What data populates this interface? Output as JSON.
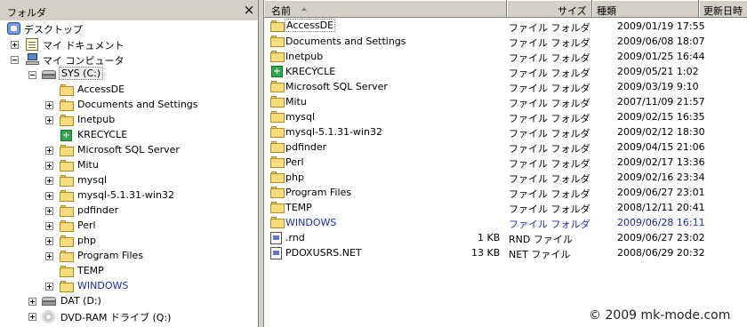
{
  "left_pane": {
    "title": "フォルダ",
    "close_glyph": "×",
    "tree": [
      {
        "label": "デスクトップ",
        "icon": "desktop-icon"
      },
      {
        "label": "マイ ドキュメント",
        "icon": "documents-icon"
      },
      {
        "label": "マイ コンピュータ",
        "icon": "computer-icon"
      },
      {
        "label": "SYS (C:)",
        "icon": "drive-icon"
      },
      {
        "label": "AccessDE",
        "icon": "folder-icon"
      },
      {
        "label": "Documents and Settings",
        "icon": "folder-icon"
      },
      {
        "label": "Inetpub",
        "icon": "folder-icon"
      },
      {
        "label": "KRECYCLE",
        "icon": "recycle-icon"
      },
      {
        "label": "Microsoft SQL Server",
        "icon": "folder-icon"
      },
      {
        "label": "Mitu",
        "icon": "folder-icon"
      },
      {
        "label": "mysql",
        "icon": "folder-icon"
      },
      {
        "label": "mysql-5.1.31-win32",
        "icon": "folder-icon"
      },
      {
        "label": "pdfinder",
        "icon": "folder-icon"
      },
      {
        "label": "Perl",
        "icon": "folder-icon"
      },
      {
        "label": "php",
        "icon": "folder-icon"
      },
      {
        "label": "Program Files",
        "icon": "folder-icon"
      },
      {
        "label": "TEMP",
        "icon": "folder-icon"
      },
      {
        "label": "WINDOWS",
        "icon": "folder-icon"
      },
      {
        "label": "DAT (D:)",
        "icon": "drive-icon"
      },
      {
        "label": "DVD-RAM ドライブ (Q:)",
        "icon": "dvd-icon"
      }
    ]
  },
  "right_pane": {
    "columns": {
      "name": "名前",
      "size": "サイズ",
      "type": "種類",
      "modified": "更新日時"
    },
    "rows": [
      {
        "name": "AccessDE",
        "size": "",
        "type": "ファイル フォルダ",
        "modified": "2009/01/19 17:55",
        "icon": "folder-icon"
      },
      {
        "name": "Documents and Settings",
        "size": "",
        "type": "ファイル フォルダ",
        "modified": "2009/06/08 18:07",
        "icon": "folder-icon"
      },
      {
        "name": "Inetpub",
        "size": "",
        "type": "ファイル フォルダ",
        "modified": "2009/01/25 16:44",
        "icon": "folder-icon"
      },
      {
        "name": "KRECYCLE",
        "size": "",
        "type": "ファイル フォルダ",
        "modified": "2009/05/21 1:02",
        "icon": "recycle-icon"
      },
      {
        "name": "Microsoft SQL Server",
        "size": "",
        "type": "ファイル フォルダ",
        "modified": "2009/03/19 9:10",
        "icon": "folder-icon"
      },
      {
        "name": "Mitu",
        "size": "",
        "type": "ファイル フォルダ",
        "modified": "2007/11/09 21:57",
        "icon": "folder-icon"
      },
      {
        "name": "mysql",
        "size": "",
        "type": "ファイル フォルダ",
        "modified": "2009/02/15 16:35",
        "icon": "folder-icon"
      },
      {
        "name": "mysql-5.1.31-win32",
        "size": "",
        "type": "ファイル フォルダ",
        "modified": "2009/02/12 18:30",
        "icon": "folder-icon"
      },
      {
        "name": "pdfinder",
        "size": "",
        "type": "ファイル フォルダ",
        "modified": "2009/04/15 21:06",
        "icon": "folder-icon"
      },
      {
        "name": "Perl",
        "size": "",
        "type": "ファイル フォルダ",
        "modified": "2009/02/17 13:36",
        "icon": "folder-icon"
      },
      {
        "name": "php",
        "size": "",
        "type": "ファイル フォルダ",
        "modified": "2009/02/16 23:34",
        "icon": "folder-icon"
      },
      {
        "name": "Program Files",
        "size": "",
        "type": "ファイル フォルダ",
        "modified": "2009/06/27 23:01",
        "icon": "folder-icon"
      },
      {
        "name": "TEMP",
        "size": "",
        "type": "ファイル フォルダ",
        "modified": "2008/12/11 20:41",
        "icon": "folder-icon"
      },
      {
        "name": "WINDOWS",
        "size": "",
        "type": "ファイル フォルダ",
        "modified": "2009/06/28 16:11",
        "icon": "folder-icon"
      },
      {
        "name": ".rnd",
        "size": "1 KB",
        "type": "RND ファイル",
        "modified": "2009/06/27 23:02",
        "icon": "file-icon"
      },
      {
        "name": "PDOXUSRS.NET",
        "size": "13 KB",
        "type": "NET ファイル",
        "modified": "2008/06/29 20:32",
        "icon": "file-icon"
      }
    ]
  },
  "watermark": "© 2009 mk-mode.com",
  "colors": {
    "system_blue_text": "#1a2ea8",
    "chrome": "#d4d0c8"
  }
}
